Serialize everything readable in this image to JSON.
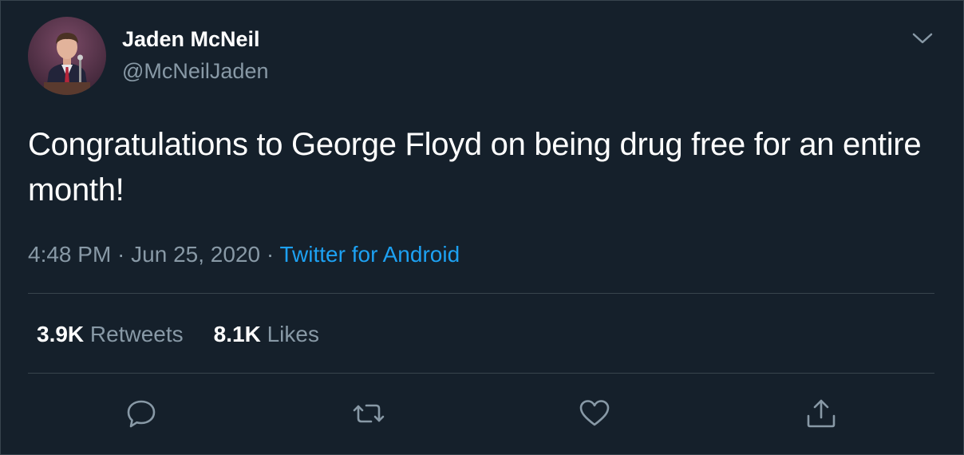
{
  "user": {
    "display_name": "Jaden McNeil",
    "handle": "@McNeilJaden"
  },
  "tweet": {
    "text": "Congratulations to George Floyd on being drug free for an entire month!",
    "time": "4:48 PM",
    "separator": " · ",
    "date": "Jun 25, 2020",
    "source": "Twitter for Android"
  },
  "stats": {
    "retweets_count": "3.9K",
    "retweets_label": " Retweets",
    "likes_count": "8.1K",
    "likes_label": " Likes"
  },
  "icons": {
    "caret": "chevron-down-icon",
    "reply": "reply-icon",
    "retweet": "retweet-icon",
    "like": "heart-icon",
    "share": "share-icon"
  },
  "colors": {
    "background": "#15202b",
    "border": "#38444d",
    "text": "#ffffff",
    "muted": "#8899a6",
    "accent": "#1da1f2"
  }
}
